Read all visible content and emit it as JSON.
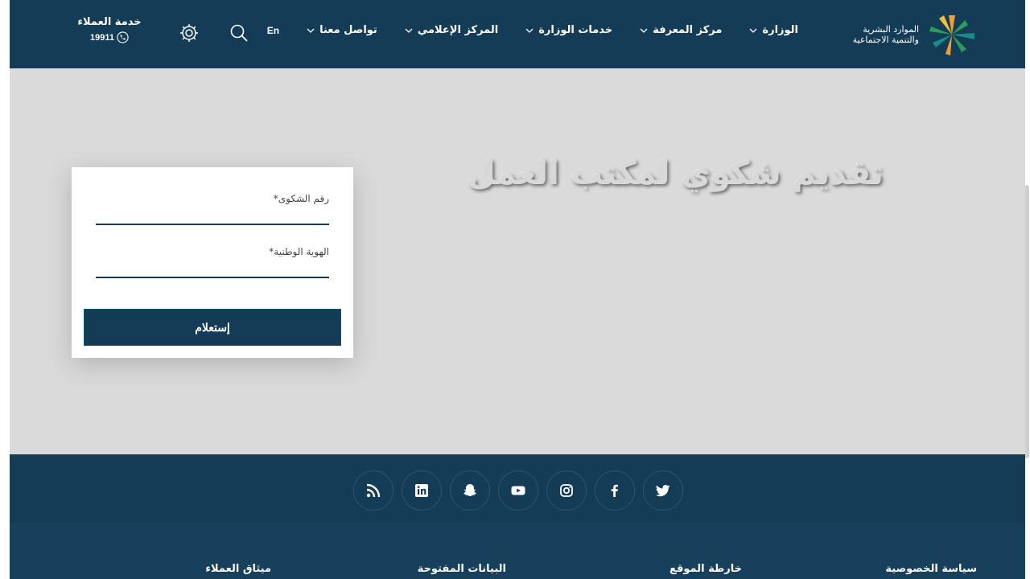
{
  "header": {
    "logo_line1": "الموارد البشرية",
    "logo_line2": "والتنمية الاجتماعية",
    "nav": [
      {
        "label": "الوزارة"
      },
      {
        "label": "مركز المعرفة"
      },
      {
        "label": "خدمات الوزارة"
      },
      {
        "label": "المركز الإعلامي"
      },
      {
        "label": "تواصل معنا"
      }
    ],
    "language": "En",
    "customer_service": "خدمة العملاء",
    "phone": "19911"
  },
  "main": {
    "title": "تقديم شكوي لمكتب العمل",
    "form": {
      "complaint_number_label": "رقم الشكوى*",
      "national_id_label": "الهوية الوطنية*",
      "submit_label": "إستعلام"
    }
  },
  "social": [
    "twitter-icon",
    "facebook-icon",
    "instagram-icon",
    "youtube-icon",
    "snapchat-icon",
    "linkedin-icon",
    "rss-icon"
  ],
  "footer": {
    "links": [
      "سياسة الخصوصية",
      "خارطة الموقع",
      "البيانات المفتوحة",
      "ميثاق العملاء"
    ]
  },
  "colors": {
    "primary": "#143c56",
    "background": "#dadada",
    "logo_green": "#2a9d5c",
    "logo_orange": "#f0a030",
    "logo_teal": "#1b8a8a"
  }
}
